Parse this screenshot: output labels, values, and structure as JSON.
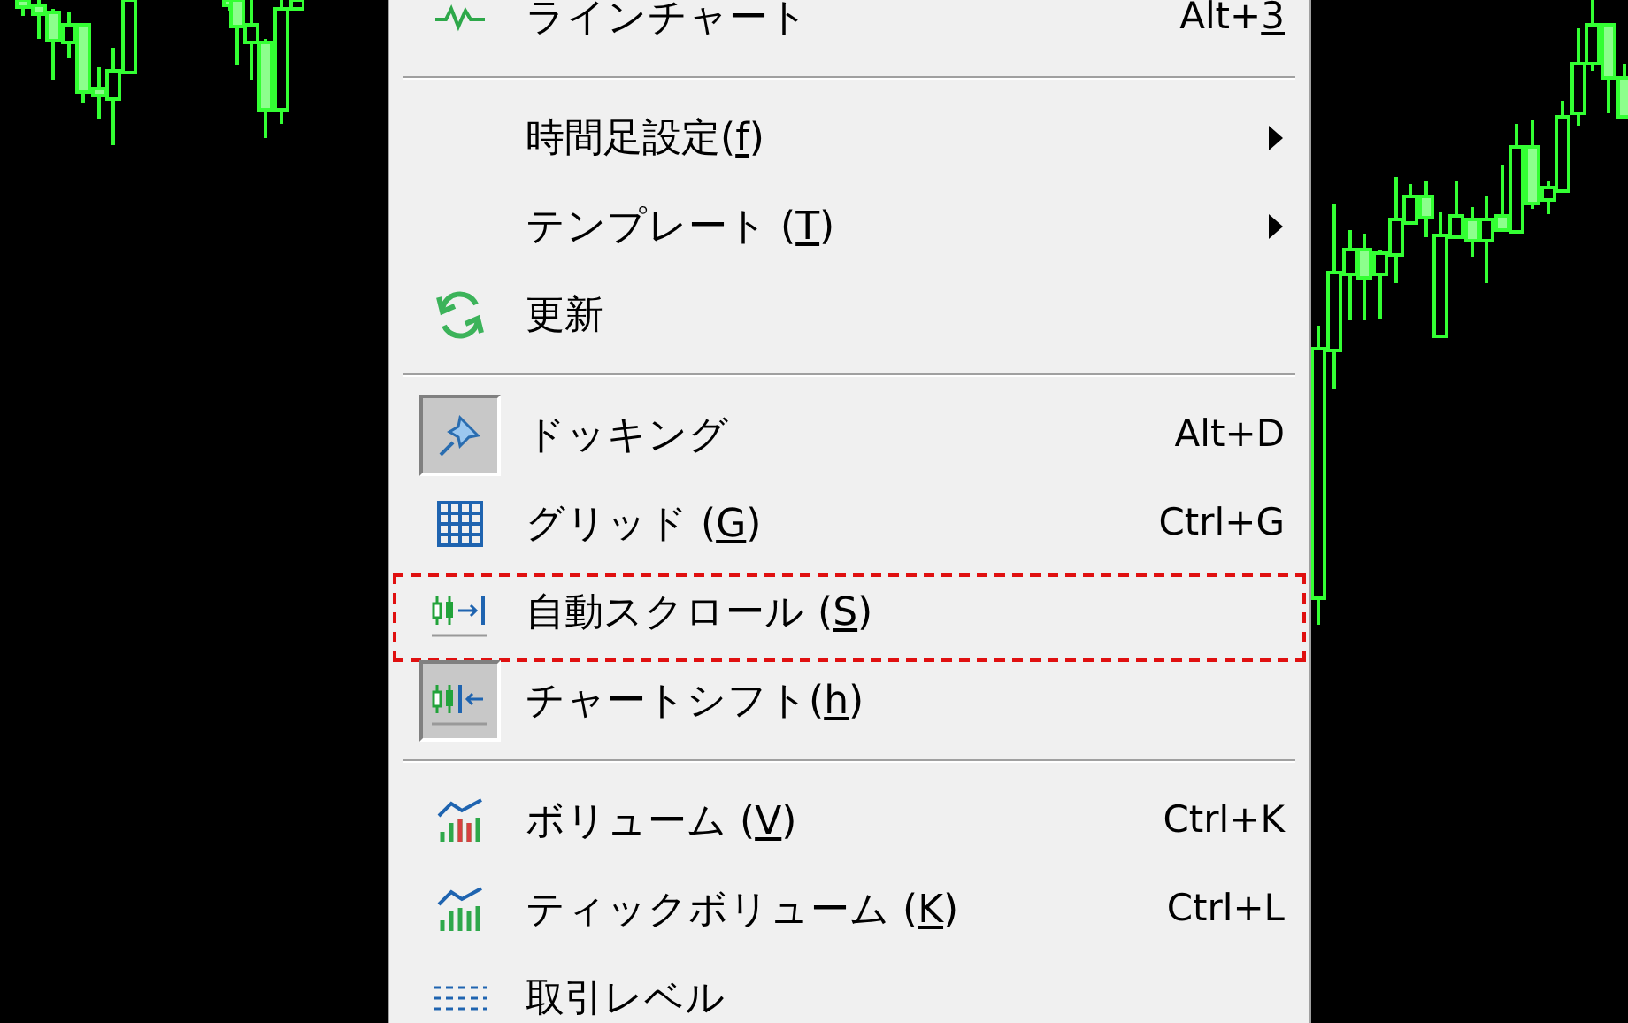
{
  "context_menu": {
    "items": [
      {
        "kind": "item",
        "label": "ラインチャート",
        "shortcut": [
          "Alt+",
          "3"
        ],
        "checked": false,
        "submenu": false,
        "highlighted": false
      },
      {
        "kind": "separator"
      },
      {
        "kind": "item",
        "label": [
          "時間足設定(",
          "f",
          ")"
        ],
        "checked": false,
        "submenu": true,
        "highlighted": false
      },
      {
        "kind": "item",
        "label": [
          "テンプレート (",
          "T",
          ")"
        ],
        "checked": false,
        "submenu": true,
        "highlighted": false
      },
      {
        "kind": "item",
        "label": "更新",
        "checked": false,
        "submenu": false,
        "highlighted": false
      },
      {
        "kind": "separator"
      },
      {
        "kind": "item",
        "label": "ドッキング",
        "shortcut": "Alt+D",
        "checked": true,
        "submenu": false,
        "highlighted": false
      },
      {
        "kind": "item",
        "label": [
          "グリッド (",
          "G",
          ")"
        ],
        "shortcut": "Ctrl+G",
        "checked": false,
        "submenu": false,
        "highlighted": false
      },
      {
        "kind": "item",
        "label": [
          "自動スクロール (",
          "S",
          ")"
        ],
        "checked": false,
        "submenu": false,
        "highlighted": true
      },
      {
        "kind": "item",
        "label": [
          "チャートシフト(",
          "h",
          ")"
        ],
        "checked": true,
        "submenu": false,
        "highlighted": false
      },
      {
        "kind": "separator"
      },
      {
        "kind": "item",
        "label": [
          "ボリューム (",
          "V",
          ")"
        ],
        "shortcut": "Ctrl+K",
        "checked": false,
        "submenu": false,
        "highlighted": false
      },
      {
        "kind": "item",
        "label": [
          "ティックボリューム (",
          "K",
          ")"
        ],
        "shortcut": "Ctrl+L",
        "checked": false,
        "submenu": false,
        "highlighted": false
      },
      {
        "kind": "item",
        "label": "取引レベル",
        "checked": false,
        "submenu": false,
        "highlighted": false
      }
    ]
  }
}
